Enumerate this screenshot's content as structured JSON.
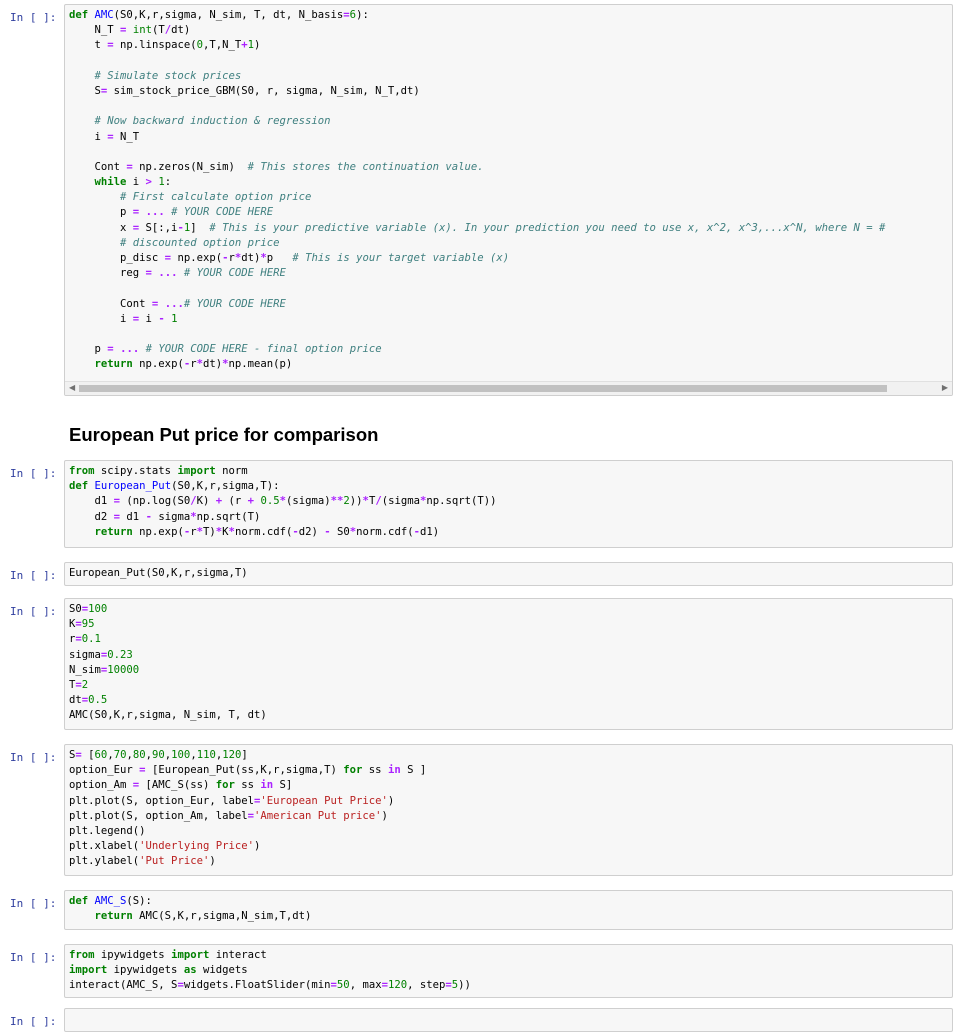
{
  "prompt": "In [ ]:",
  "cells": [
    {
      "id": "amc",
      "lines": [
        "def AMC(S0,K,r,sigma, N_sim, T, dt, N_basis=6):",
        "    N_T = int(T/dt)",
        "    t = np.linspace(0,T,N_T+1)",
        "",
        "    # Simulate stock prices",
        "    S= sim_stock_price_GBM(S0, r, sigma, N_sim, N_T,dt)",
        "",
        "    # Now backward induction & regression",
        "    i = N_T",
        "",
        "    Cont = np.zeros(N_sim)  # This stores the continuation value.",
        "    while i > 1:",
        "        # First calculate option price",
        "        p = ... # YOUR CODE HERE",
        "        x = S[:,i-1]  # This is your predictive variable (x). In your prediction you need to use x, x^2, x^3,...x^N, where N = #",
        "        # discounted option price",
        "        p_disc = np.exp(-r*dt)*p   # This is your target variable (x)",
        "        reg = ... # YOUR CODE HERE",
        "",
        "        Cont = ...# YOUR CODE HERE",
        "        i = i - 1",
        "",
        "    p = ... # YOUR CODE HERE - final option price",
        "    return np.exp(-r*dt)*np.mean(p)"
      ]
    },
    {
      "id": "heading",
      "text": "European Put price for comparison"
    },
    {
      "id": "european",
      "lines": [
        "from scipy.stats import norm",
        "def European_Put(S0,K,r,sigma,T):",
        "    d1 = (np.log(S0/K) + (r + 0.5*(sigma)**2))*T/(sigma*np.sqrt(T))",
        "    d2 = d1 - sigma*np.sqrt(T)",
        "    return np.exp(-r*T)*K*norm.cdf(-d2) - S0*norm.cdf(-d1)"
      ]
    },
    {
      "id": "call",
      "lines": [
        "European_Put(S0,K,r,sigma,T)"
      ]
    },
    {
      "id": "params",
      "lines": [
        "S0=100",
        "K=95",
        "r=0.1",
        "sigma=0.23",
        "N_sim=10000",
        "T=2",
        "dt=0.5",
        "AMC(S0,K,r,sigma, N_sim, T, dt)"
      ]
    },
    {
      "id": "plot",
      "lines": [
        "S= [60,70,80,90,100,110,120]",
        "option_Eur = [European_Put(ss,K,r,sigma,T) for ss in S ]",
        "option_Am = [AMC_S(ss) for ss in S]",
        "plt.plot(S, option_Eur, label='European Put Price')",
        "plt.plot(S, option_Am, label='American Put price')",
        "plt.legend()",
        "plt.xlabel('Underlying Price')",
        "plt.ylabel('Put Price')"
      ]
    },
    {
      "id": "amcs",
      "lines": [
        "def AMC_S(S):",
        "    return AMC(S,K,r,sigma,N_sim,T,dt)"
      ]
    },
    {
      "id": "interact",
      "lines": [
        "from ipywidgets import interact",
        "import ipywidgets as widgets",
        "interact(AMC_S, S=widgets.FloatSlider(min=50, max=120, step=5))"
      ]
    },
    {
      "id": "empty",
      "lines": [
        ""
      ]
    }
  ]
}
